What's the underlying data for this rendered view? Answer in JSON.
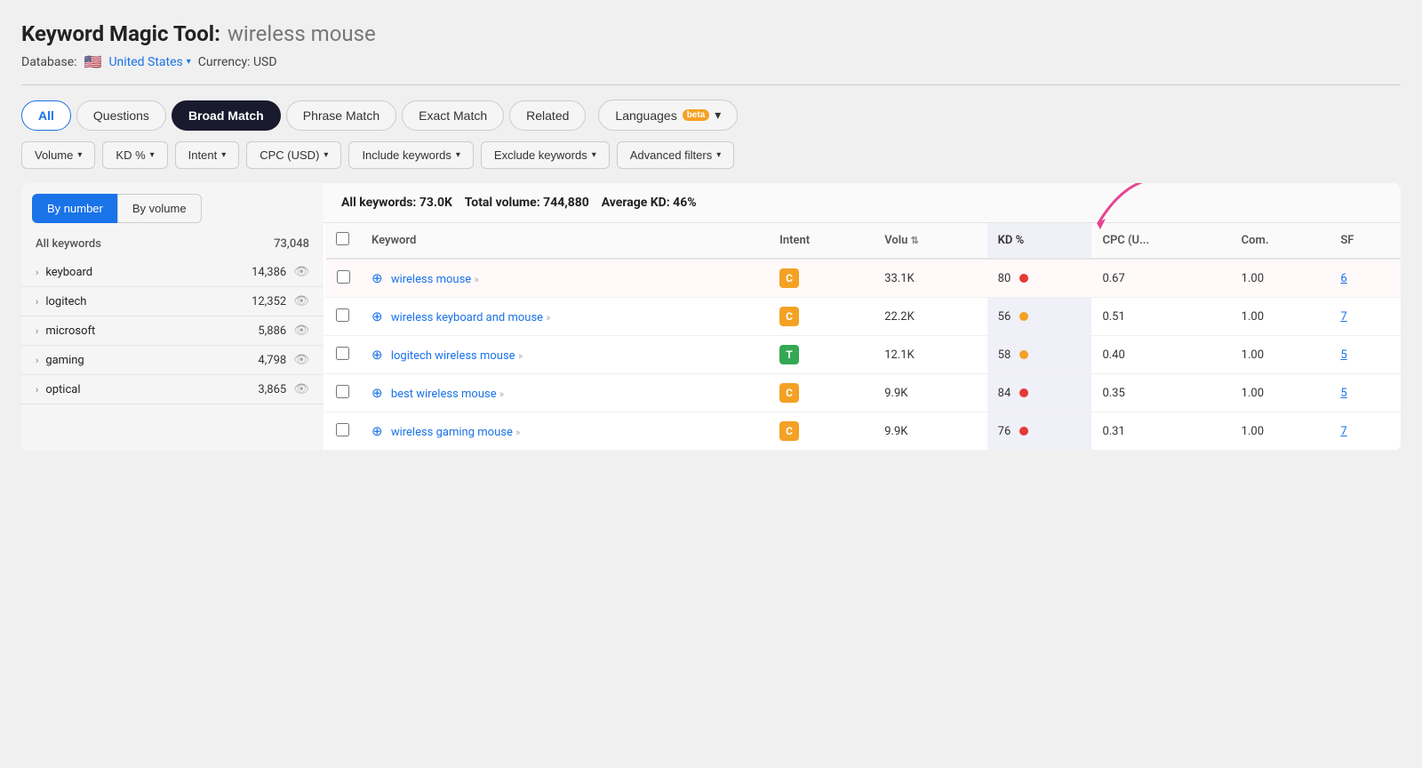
{
  "header": {
    "title_main": "Keyword Magic Tool:",
    "title_query": "wireless mouse",
    "database_label": "Database:",
    "database_value": "United States",
    "currency_label": "Currency: USD"
  },
  "tabs": [
    {
      "id": "all",
      "label": "All",
      "active": true,
      "selected_dark": false
    },
    {
      "id": "questions",
      "label": "Questions",
      "active": false,
      "selected_dark": false
    },
    {
      "id": "broad-match",
      "label": "Broad Match",
      "active": false,
      "selected_dark": true
    },
    {
      "id": "phrase-match",
      "label": "Phrase Match",
      "active": false,
      "selected_dark": false
    },
    {
      "id": "exact-match",
      "label": "Exact Match",
      "active": false,
      "selected_dark": false
    },
    {
      "id": "related",
      "label": "Related",
      "active": false,
      "selected_dark": false
    },
    {
      "id": "languages",
      "label": "Languages",
      "active": false,
      "selected_dark": false,
      "has_beta": true,
      "has_chevron": true
    }
  ],
  "filters": [
    {
      "id": "volume",
      "label": "Volume"
    },
    {
      "id": "kd",
      "label": "KD %"
    },
    {
      "id": "intent",
      "label": "Intent"
    },
    {
      "id": "cpc",
      "label": "CPC (USD)"
    },
    {
      "id": "include-keywords",
      "label": "Include keywords"
    },
    {
      "id": "exclude-keywords",
      "label": "Exclude keywords"
    },
    {
      "id": "advanced-filters",
      "label": "Advanced filters"
    }
  ],
  "sidebar": {
    "toggle": {
      "by_number": "By number",
      "by_volume": "By volume",
      "active": "by_number"
    },
    "header_left": "All keywords",
    "header_right": "73,048",
    "items": [
      {
        "name": "keyboard",
        "count": "14,386"
      },
      {
        "name": "logitech",
        "count": "12,352"
      },
      {
        "name": "microsoft",
        "count": "5,886"
      },
      {
        "name": "gaming",
        "count": "4,798"
      },
      {
        "name": "optical",
        "count": "3,865"
      }
    ]
  },
  "table_summary": {
    "all_keywords_label": "All keywords:",
    "all_keywords_value": "73.0K",
    "total_volume_label": "Total volume:",
    "total_volume_value": "744,880",
    "avg_kd_label": "Average KD:",
    "avg_kd_value": "46%"
  },
  "table": {
    "columns": [
      {
        "id": "keyword",
        "label": "Keyword"
      },
      {
        "id": "intent",
        "label": "Intent"
      },
      {
        "id": "volume",
        "label": "Volu",
        "has_sort": true
      },
      {
        "id": "kd",
        "label": "KD %",
        "highlighted": true
      },
      {
        "id": "cpc",
        "label": "CPC (U..."
      },
      {
        "id": "com",
        "label": "Com."
      },
      {
        "id": "sf",
        "label": "SF"
      }
    ],
    "rows": [
      {
        "highlighted": true,
        "keyword": "wireless mouse",
        "has_arrows": true,
        "intent": "C",
        "intent_class": "intent-c",
        "volume": "33.1K",
        "kd": "80",
        "kd_dot": "dot-red",
        "cpc": "0.67",
        "com": "1.00",
        "sf": "6"
      },
      {
        "highlighted": false,
        "keyword": "wireless keyboard and mouse",
        "has_arrows": true,
        "intent": "C",
        "intent_class": "intent-c",
        "volume": "22.2K",
        "kd": "56",
        "kd_dot": "dot-orange",
        "cpc": "0.51",
        "com": "1.00",
        "sf": "7"
      },
      {
        "highlighted": false,
        "keyword": "logitech wireless mouse",
        "has_arrows": true,
        "intent": "T",
        "intent_class": "intent-t",
        "volume": "12.1K",
        "kd": "58",
        "kd_dot": "dot-orange",
        "cpc": "0.40",
        "com": "1.00",
        "sf": "5"
      },
      {
        "highlighted": false,
        "keyword": "best wireless mouse",
        "has_arrows": true,
        "intent": "C",
        "intent_class": "intent-c",
        "volume": "9.9K",
        "kd": "84",
        "kd_dot": "dot-red",
        "cpc": "0.35",
        "com": "1.00",
        "sf": "5"
      },
      {
        "highlighted": false,
        "keyword": "wireless gaming mouse",
        "has_arrows": true,
        "intent": "C",
        "intent_class": "intent-c",
        "volume": "9.9K",
        "kd": "76",
        "kd_dot": "dot-red",
        "cpc": "0.31",
        "com": "1.00",
        "sf": "7"
      }
    ]
  },
  "icons": {
    "chevron_down": "▾",
    "chevron_right": "›",
    "eye": "👁",
    "flag_us": "🇺🇸"
  }
}
